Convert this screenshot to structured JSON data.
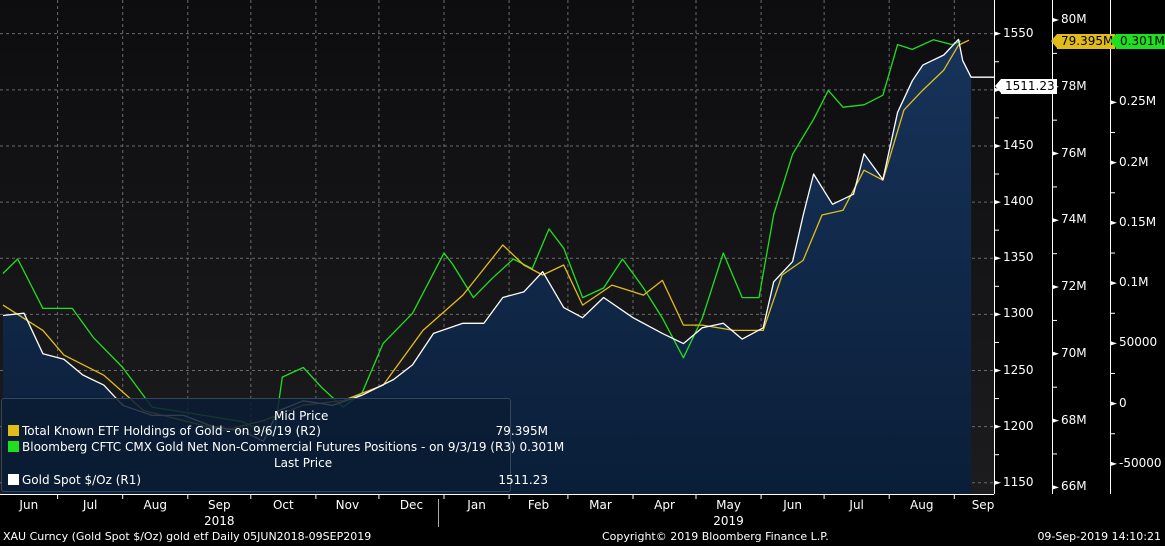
{
  "chart_data": {
    "type": "line",
    "x_unit": "days since 05JUN2018",
    "start_date": "2018-06-05",
    "end_date": "2019-09-09",
    "x_months": [
      "Jun",
      "Jul",
      "Aug",
      "Sep",
      "Oct",
      "Nov",
      "Dec",
      "Jan",
      "Feb",
      "Mar",
      "Apr",
      "May",
      "Jun",
      "Jul",
      "Aug",
      "Sep"
    ],
    "x_years": [
      {
        "label": "2018",
        "month_index": 3
      },
      {
        "label": "2019",
        "month_index": 11
      }
    ],
    "axes": {
      "R1": {
        "ylim": [
          1140,
          1580
        ],
        "ticks": [
          1150,
          1200,
          1250,
          1300,
          1350,
          1400,
          1450,
          1500,
          1550
        ],
        "labels": [
          "1150",
          "1200",
          "1250",
          "1300",
          "1350",
          "1400",
          "1450",
          "1500",
          "1550"
        ]
      },
      "R2": {
        "ylim": [
          65.8,
          80.6
        ],
        "ticks": [
          66,
          68,
          70,
          72,
          74,
          76,
          78,
          80
        ],
        "labels": [
          "66M",
          "68M",
          "70M",
          "72M",
          "74M",
          "76M",
          "78M",
          "80M"
        ]
      },
      "R3": {
        "ylim": [
          -75000,
          335000
        ],
        "ticks": [
          -50000,
          0,
          50000,
          100000,
          150000,
          200000,
          250000
        ],
        "labels": [
          "-50000",
          "0",
          "50000",
          "0.1M",
          "0.15M",
          "0.2M",
          "0.25M"
        ]
      }
    },
    "series": [
      {
        "name": "Gold Spot $/Oz",
        "axis": "R1",
        "color": "#ffffff",
        "area": true,
        "last": "1511.23",
        "legend": "Gold Spot $/Oz  (R1)",
        "points": [
          [
            0,
            1299
          ],
          [
            10,
            1301
          ],
          [
            19,
            1265
          ],
          [
            29,
            1260
          ],
          [
            38,
            1246
          ],
          [
            48,
            1237
          ],
          [
            57,
            1219
          ],
          [
            71,
            1210
          ],
          [
            86,
            1210
          ],
          [
            100,
            1200
          ],
          [
            114,
            1196
          ],
          [
            124,
            1187
          ],
          [
            131,
            1214
          ],
          [
            143,
            1223
          ],
          [
            157,
            1219
          ],
          [
            171,
            1228
          ],
          [
            186,
            1242
          ],
          [
            195,
            1255
          ],
          [
            205,
            1283
          ],
          [
            219,
            1292
          ],
          [
            229,
            1292
          ],
          [
            238,
            1315
          ],
          [
            248,
            1320
          ],
          [
            257,
            1338
          ],
          [
            267,
            1306
          ],
          [
            276,
            1297
          ],
          [
            286,
            1315
          ],
          [
            300,
            1297
          ],
          [
            314,
            1283
          ],
          [
            324,
            1274
          ],
          [
            333,
            1288
          ],
          [
            343,
            1292
          ],
          [
            352,
            1278
          ],
          [
            362,
            1288
          ],
          [
            367,
            1329
          ],
          [
            376,
            1347
          ],
          [
            381,
            1388
          ],
          [
            386,
            1425
          ],
          [
            395,
            1398
          ],
          [
            405,
            1407
          ],
          [
            410,
            1443
          ],
          [
            419,
            1420
          ],
          [
            426,
            1480
          ],
          [
            433,
            1508
          ],
          [
            438,
            1522
          ],
          [
            448,
            1531
          ],
          [
            455,
            1545
          ],
          [
            457,
            1526
          ],
          [
            461,
            1511.23
          ]
        ]
      },
      {
        "name": "Total Known ETF Holdings of Gold",
        "axis": "R2",
        "color": "#e2bd1a",
        "last": "79.395M",
        "legend": "Total Known ETF Holdings of Gold -  on 9/6/19  (R2)",
        "points": [
          [
            0,
            71.46
          ],
          [
            19,
            70.7
          ],
          [
            29,
            69.96
          ],
          [
            48,
            69.36
          ],
          [
            67,
            68.3
          ],
          [
            86,
            68.0
          ],
          [
            105,
            67.7
          ],
          [
            124,
            68.0
          ],
          [
            143,
            68.46
          ],
          [
            162,
            68.6
          ],
          [
            181,
            69.06
          ],
          [
            200,
            70.7
          ],
          [
            219,
            71.76
          ],
          [
            238,
            73.26
          ],
          [
            248,
            72.66
          ],
          [
            257,
            72.36
          ],
          [
            267,
            72.66
          ],
          [
            276,
            71.46
          ],
          [
            290,
            72.06
          ],
          [
            305,
            71.76
          ],
          [
            314,
            72.2
          ],
          [
            324,
            70.86
          ],
          [
            333,
            70.86
          ],
          [
            348,
            70.7
          ],
          [
            362,
            70.7
          ],
          [
            371,
            72.36
          ],
          [
            381,
            72.8
          ],
          [
            390,
            74.16
          ],
          [
            400,
            74.3
          ],
          [
            410,
            75.5
          ],
          [
            419,
            75.2
          ],
          [
            429,
            77.3
          ],
          [
            438,
            77.9
          ],
          [
            448,
            78.5
          ],
          [
            455,
            79.25
          ],
          [
            460,
            79.395
          ]
        ]
      },
      {
        "name": "Bloomberg CFTC CMX Gold Net Non-Commercial Futures Positions",
        "axis": "R3",
        "color": "#1fe01f",
        "last": "0.301M",
        "legend": "Bloomberg CFTC CMX Gold Net Non-Commercial Futures Positions -  on 9/3/19  (R3)",
        "points": [
          [
            0,
            108000
          ],
          [
            7,
            120000
          ],
          [
            19,
            79000
          ],
          [
            33,
            79000
          ],
          [
            43,
            55000
          ],
          [
            57,
            30000
          ],
          [
            71,
            -3000
          ],
          [
            86,
            -7000
          ],
          [
            100,
            -11000
          ],
          [
            114,
            -15000
          ],
          [
            129,
            -27000
          ],
          [
            133,
            22000
          ],
          [
            143,
            30000
          ],
          [
            152,
            13000
          ],
          [
            162,
            -3000
          ],
          [
            171,
            9000
          ],
          [
            181,
            50000
          ],
          [
            195,
            75000
          ],
          [
            210,
            125000
          ],
          [
            214,
            116000
          ],
          [
            224,
            88000
          ],
          [
            233,
            104000
          ],
          [
            243,
            120000
          ],
          [
            252,
            112000
          ],
          [
            260,
            145000
          ],
          [
            267,
            129000
          ],
          [
            276,
            88000
          ],
          [
            286,
            96000
          ],
          [
            295,
            120000
          ],
          [
            305,
            96000
          ],
          [
            314,
            71000
          ],
          [
            324,
            38000
          ],
          [
            333,
            71000
          ],
          [
            343,
            125000
          ],
          [
            352,
            88000
          ],
          [
            360,
            88000
          ],
          [
            367,
            157000
          ],
          [
            376,
            207000
          ],
          [
            386,
            236000
          ],
          [
            393,
            260000
          ],
          [
            400,
            246000
          ],
          [
            410,
            248000
          ],
          [
            419,
            256000
          ],
          [
            426,
            298000
          ],
          [
            433,
            294000
          ],
          [
            443,
            302000
          ],
          [
            452,
            298000
          ],
          [
            456,
            301000
          ]
        ]
      }
    ],
    "legend_headers": {
      "mid": "Mid Price",
      "last": "Last Price"
    },
    "legend_placement": "bottom-left",
    "grid": true
  },
  "footer": {
    "left": "XAU Curncy (Gold Spot   $/Oz) gold etf  Daily 05JUN2018-09SEP2019",
    "center": "Copyright© 2019 Bloomberg Finance L.P.",
    "right": "09-Sep-2019 14:10:21"
  }
}
